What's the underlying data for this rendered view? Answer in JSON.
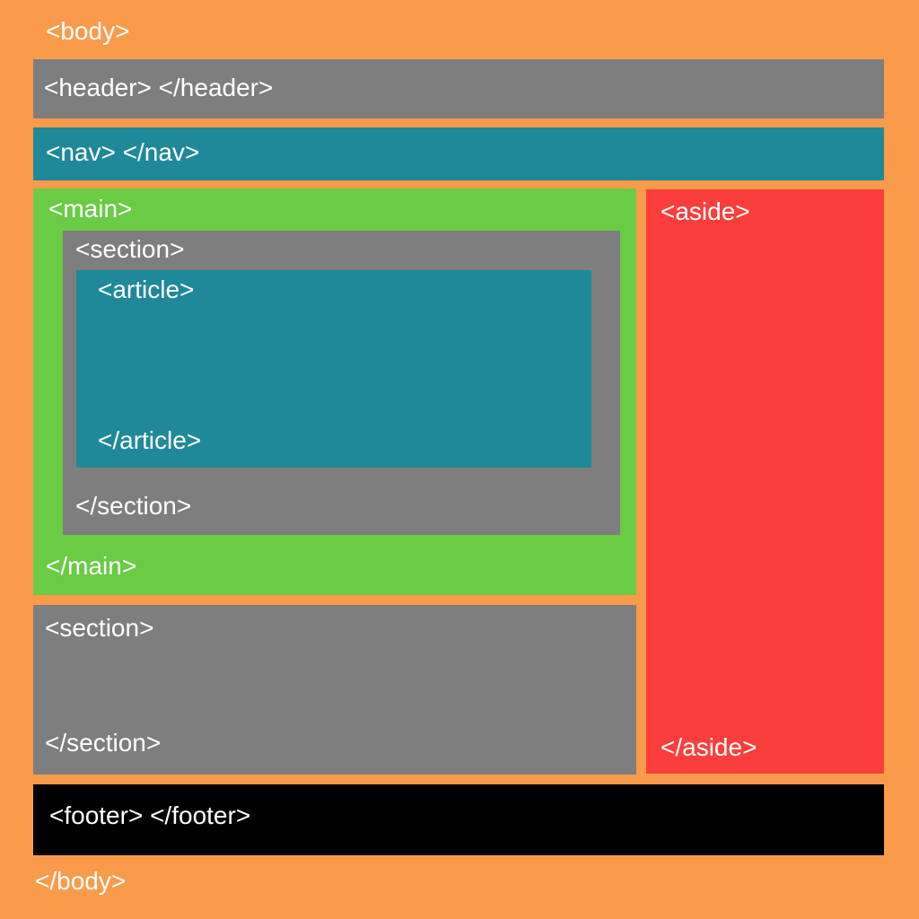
{
  "body": {
    "open": "<body>",
    "close": "</body>"
  },
  "header": {
    "text": "<header> </header>"
  },
  "nav": {
    "text": "<nav>   </nav>"
  },
  "main": {
    "open": "<main>",
    "close": "</main>",
    "section": {
      "open": "<section>",
      "close": "</section>",
      "article": {
        "open": "<article>",
        "close": "</article>"
      }
    }
  },
  "section2": {
    "open": "<section>",
    "close": "</section>"
  },
  "aside": {
    "open": "<aside>",
    "close": "</aside>"
  },
  "footer": {
    "text": "<footer>    </footer>"
  },
  "colors": {
    "body_bg": "#fa9b4c",
    "header_bg": "#7e7e7e",
    "nav_bg": "#1f8999",
    "main_bg": "#6acb45",
    "section_bg": "#7e7e7e",
    "article_bg": "#1f8999",
    "aside_bg": "#fa3e3b",
    "footer_bg": "#000000"
  }
}
